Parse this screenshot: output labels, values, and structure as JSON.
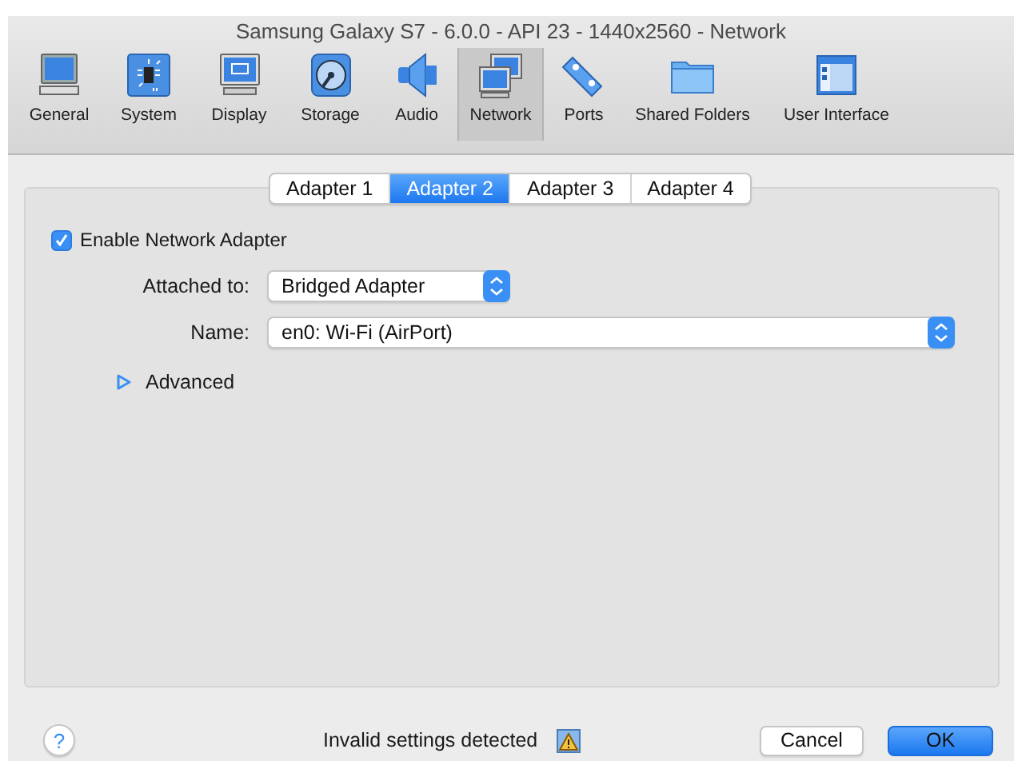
{
  "window": {
    "title": "Samsung Galaxy S7 - 6.0.0 - API 23 - 1440x2560 - Network"
  },
  "toolbar": [
    {
      "label": "General",
      "selected": false
    },
    {
      "label": "System",
      "selected": false
    },
    {
      "label": "Display",
      "selected": false
    },
    {
      "label": "Storage",
      "selected": false
    },
    {
      "label": "Audio",
      "selected": false
    },
    {
      "label": "Network",
      "selected": true
    },
    {
      "label": "Ports",
      "selected": false
    },
    {
      "label": "Shared Folders",
      "selected": false
    },
    {
      "label": "User Interface",
      "selected": false
    }
  ],
  "tabs": [
    {
      "label": "Adapter 1",
      "selected": false
    },
    {
      "label": "Adapter 2",
      "selected": true
    },
    {
      "label": "Adapter 3",
      "selected": false
    },
    {
      "label": "Adapter 4",
      "selected": false
    }
  ],
  "enable_adapter": {
    "label": "Enable Network Adapter",
    "checked": true
  },
  "attached_to": {
    "label": "Attached to:",
    "value": "Bridged Adapter"
  },
  "name": {
    "label": "Name:",
    "value": "en0: Wi-Fi (AirPort)"
  },
  "advanced": {
    "label": "Advanced",
    "expanded": false
  },
  "help": "?",
  "status": {
    "text": "Invalid settings detected"
  },
  "buttons": [
    {
      "label": "Cancel",
      "kind": "secondary"
    },
    {
      "label": "OK",
      "kind": "default"
    }
  ]
}
